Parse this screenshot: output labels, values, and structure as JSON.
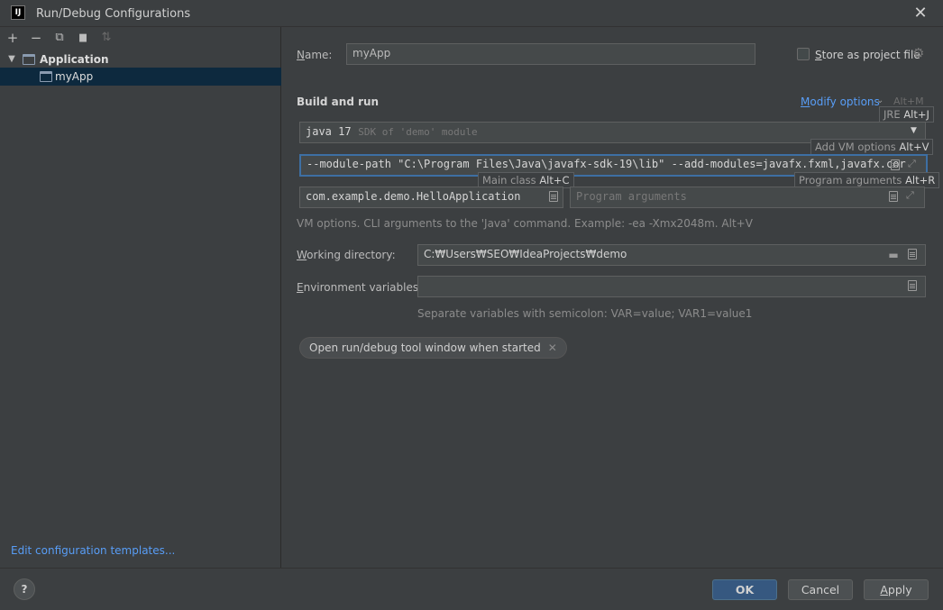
{
  "window": {
    "title": "Run/Debug Configurations",
    "logo_text": "IJ",
    "close_glyph": "✕"
  },
  "sidebar": {
    "toolbar": [
      {
        "name": "add-icon",
        "glyph": "+"
      },
      {
        "name": "remove-icon",
        "glyph": "−"
      },
      {
        "name": "copy-icon",
        "glyph": "⧉"
      },
      {
        "name": "folder-add-icon",
        "glyph": "▆"
      },
      {
        "name": "sort-icon",
        "glyph": "⇅"
      }
    ],
    "tree": {
      "group_label": "Application",
      "item_label": "myApp"
    },
    "edit_templates_link": "Edit configuration templates..."
  },
  "form": {
    "name_label_accel": "N",
    "name_label_rest": "ame:",
    "name_value": "myApp",
    "store_label_accel": "S",
    "store_label_rest": "tore as project file",
    "section_title": "Build and run",
    "modify_options": {
      "label_accel": "M",
      "label_rest": "odify options",
      "shortcut": "Alt+M"
    },
    "sdk": {
      "value": "java 17",
      "detail": "SDK of 'demo' module"
    },
    "jre_hint": {
      "text": "JRE ",
      "key": "Alt+J"
    },
    "vm_hint": {
      "text": "Add VM options ",
      "key": "Alt+V"
    },
    "vm_options_value": "--module-path \"C:\\Program Files\\Java\\javafx-sdk-19\\lib\" --add-modules=javafx.fxml,javafx.cor",
    "main_class_hint": {
      "text": "Main class ",
      "key": "Alt+C"
    },
    "main_class_value": "com.example.demo.HelloApplication",
    "program_args_placeholder": "Program arguments",
    "program_args_hint": {
      "text": "Program arguments ",
      "key": "Alt+R"
    },
    "vm_help_text": "VM options. CLI arguments to the 'Java' command. Example: -ea -Xmx2048m. Alt+V",
    "working_dir_label_accel": "W",
    "working_dir_label_rest": "orking directory:",
    "working_dir_value": "C:₩Users₩SEO₩IdeaProjects₩demo",
    "env_label_accel": "E",
    "env_label_rest": "nvironment variables:",
    "env_value": "",
    "env_help_text": "Separate variables with semicolon: VAR=value; VAR1=value1",
    "chip_label": "Open run/debug tool window when started"
  },
  "footer": {
    "help": "?",
    "ok": "OK",
    "cancel": "Cancel",
    "apply_accel": "A",
    "apply_rest": "pply"
  },
  "colors": {
    "background": "#3c3f41",
    "field_bg": "#45494a",
    "selection": "#0d293e",
    "link": "#589df6",
    "focus_border": "#3d6fa3",
    "primary_button": "#365880"
  }
}
